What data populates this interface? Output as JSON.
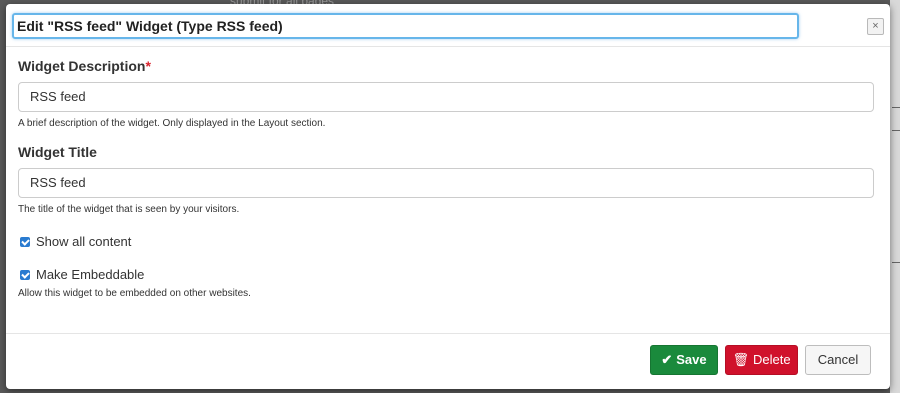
{
  "background": {
    "snippet": "submit for all pages"
  },
  "modal": {
    "title": "Edit \"RSS feed\" Widget (Type RSS feed)",
    "close_icon": "×"
  },
  "fields": {
    "description": {
      "label": "Widget Description",
      "required_mark": "*",
      "value": "RSS feed",
      "help": "A brief description of the widget. Only displayed in the Layout section."
    },
    "title": {
      "label": "Widget Title",
      "value": "RSS feed",
      "help": "The title of the widget that is seen by your visitors."
    }
  },
  "options": {
    "show_all": {
      "label": "Show all content",
      "checked": true
    },
    "embeddable": {
      "label": "Make Embeddable",
      "checked": true,
      "help": "Allow this widget to be embedded on other websites."
    }
  },
  "footer": {
    "save_label": "Save",
    "delete_label": "Delete",
    "cancel_label": "Cancel",
    "save_icon": "✔",
    "delete_icon": "🗑"
  },
  "colors": {
    "save": "#1a8a3c",
    "delete": "#d0112b",
    "focus_border": "#67b6ea",
    "checkbox": "#2a7bd0",
    "required": "#d9232d"
  }
}
